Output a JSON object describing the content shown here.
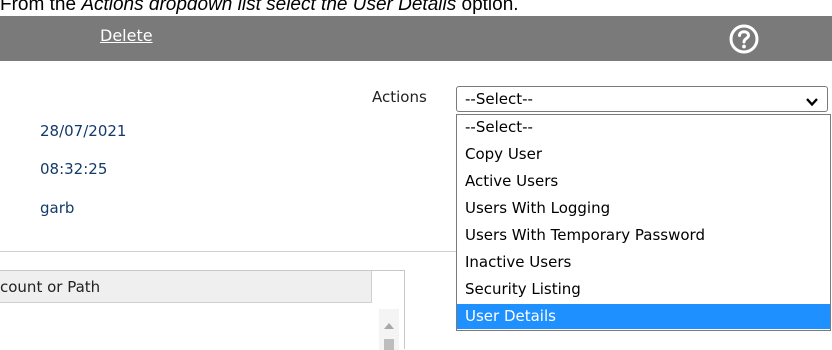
{
  "caption": {
    "prefix": "From the ",
    "actions_word": "Actions",
    "middle": " dropdown list select the ",
    "target_word": "User Details",
    "suffix": " option."
  },
  "toolbar": {
    "delete_label": "Delete",
    "help_icon": "help-circle-icon",
    "background": "#7a7a7a"
  },
  "actions": {
    "label": "Actions",
    "selected_value": "--Select--",
    "options": [
      "--Select--",
      "Copy User",
      "Active Users",
      "Users With Logging",
      "Users With Temporary Password",
      "Inactive Users",
      "Security Listing",
      "User Details"
    ],
    "highlighted_option": "User Details",
    "highlight_color": "#1e90ff"
  },
  "info": {
    "date": "28/07/2021",
    "time": "08:32:25",
    "user": "garb"
  },
  "table": {
    "column_header": "count or Path"
  }
}
